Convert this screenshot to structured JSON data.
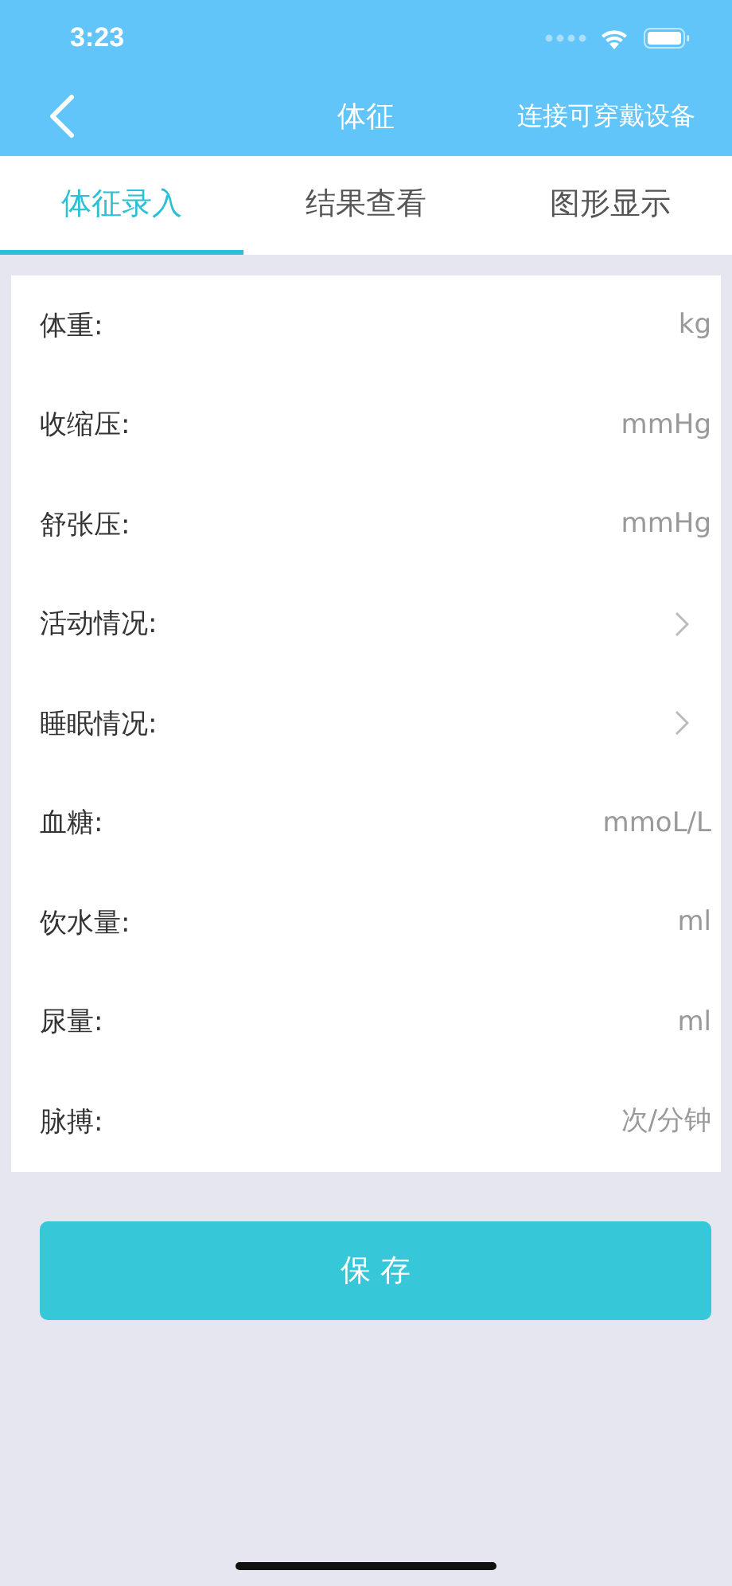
{
  "status_bar": {
    "time": "3:23"
  },
  "nav": {
    "title": "体征",
    "action": "连接可穿戴设备"
  },
  "tabs": [
    {
      "label": "体征录入",
      "selected": true
    },
    {
      "label": "结果查看",
      "selected": false
    },
    {
      "label": "图形显示",
      "selected": false
    }
  ],
  "form_rows": [
    {
      "kind": "input",
      "label": "体重:",
      "placeholder": "kg"
    },
    {
      "kind": "input",
      "label": "收缩压:",
      "placeholder": "mmHg"
    },
    {
      "kind": "input",
      "label": "舒张压:",
      "placeholder": "mmHg"
    },
    {
      "kind": "select",
      "label": "活动情况:"
    },
    {
      "kind": "select",
      "label": "睡眠情况:"
    },
    {
      "kind": "input",
      "label": "血糖:",
      "placeholder": "mmoL/L"
    },
    {
      "kind": "input",
      "label": "饮水量:",
      "placeholder": "ml"
    },
    {
      "kind": "input",
      "label": "尿量:",
      "placeholder": "ml"
    },
    {
      "kind": "input",
      "label": "脉搏:",
      "placeholder": "次/分钟"
    }
  ],
  "save_button": "保 存"
}
